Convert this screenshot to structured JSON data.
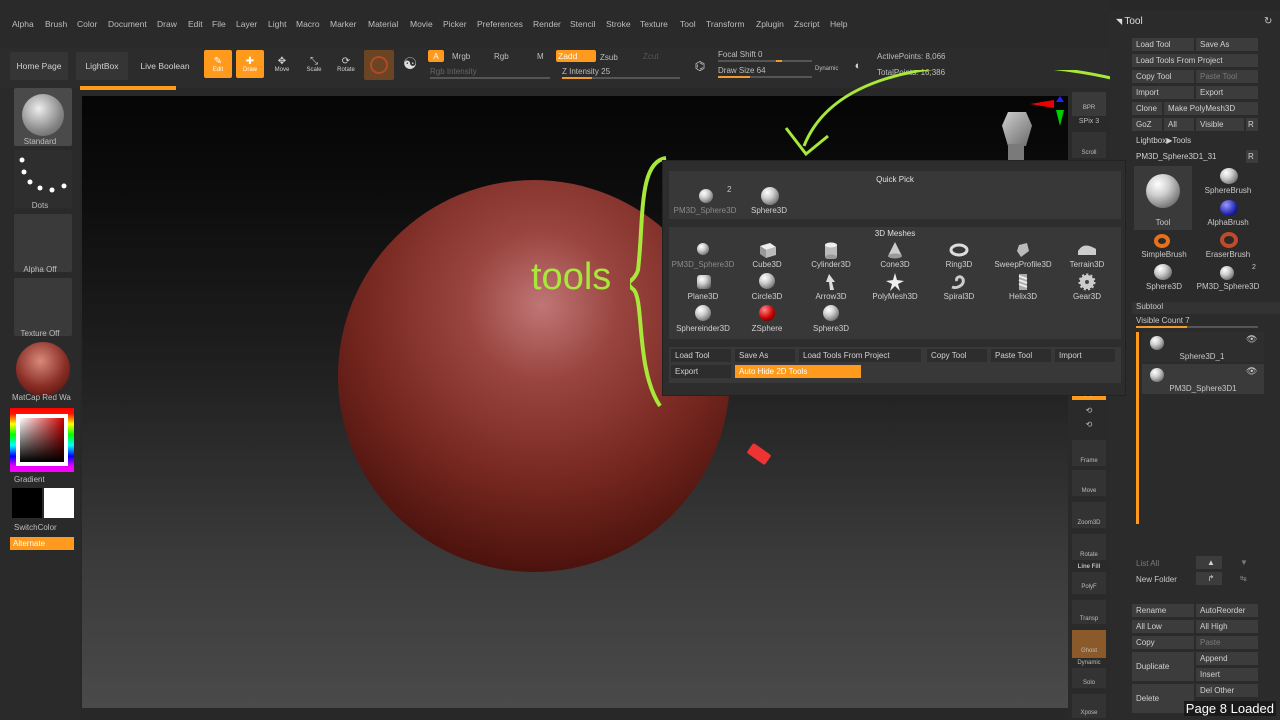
{
  "menu": [
    "Alpha",
    "Brush",
    "Color",
    "Document",
    "Draw",
    "Edit",
    "File",
    "Layer",
    "Light",
    "Macro",
    "Marker",
    "Material",
    "Movie",
    "Picker",
    "Preferences",
    "Render",
    "Stencil",
    "Stroke",
    "Texture",
    "Tool",
    "Transform",
    "Zplugin",
    "Zscript",
    "Help"
  ],
  "topbar": {
    "home": "Home Page",
    "lightbox": "LightBox",
    "liveboolean": "Live Boolean",
    "edit": "Edit",
    "draw": "Draw",
    "move": "Move",
    "scale": "Scale",
    "rotate": "Rotate",
    "a": "A",
    "mrgb": "Mrgb",
    "rgb": "Rgb",
    "m": "M",
    "zadd": "Zadd",
    "zsub": "Zsub",
    "zcut": "Zcut",
    "rgb_intensity": "Rgb Intensity",
    "z_intensity": "Z Intensity 25",
    "focal": "Focal Shift 0",
    "drawsize": "Draw Size 64",
    "dynamic": "Dynamic",
    "active": "ActivePoints: 8,066",
    "total": "TotalPoints: 16,386",
    "z_intensity_level": 0.25,
    "draw_size_level": 0.5
  },
  "left": {
    "standard": "Standard",
    "dots": "Dots",
    "alphaoff": "Alpha Off",
    "textureoff": "Texture Off",
    "matcap": "MatCap Red Wa",
    "gradient": "Gradient",
    "switchcolor": "SwitchColor",
    "alternate": "Alternate"
  },
  "annotation": "tools",
  "rightstrip": {
    "bpr": "BPR",
    "spix": "SPix 3",
    "scroll": "Scroll",
    "frame": "Frame",
    "move": "Move",
    "zoom3d": "Zoom3D",
    "rotate": "Rotate",
    "linefill": "Line Fill",
    "polyf": "PolyF",
    "transp": "Transp",
    "ghost": "Ghost",
    "dynamic": "Dynamic",
    "solo": "Solo",
    "xpose": "Xpose"
  },
  "tool": {
    "title": "Tool",
    "loadtool": "Load Tool",
    "saveas": "Save As",
    "loadfromproject": "Load Tools From Project",
    "copytool": "Copy Tool",
    "pastetool": "Paste Tool",
    "import": "Import",
    "export": "Export",
    "clone": "Clone",
    "makepolymesh": "Make PolyMesh3D",
    "goz": "GoZ",
    "all": "All",
    "visible": "Visible",
    "r": "R",
    "lightbox_tools": "Lightbox▶Tools",
    "current": "PM3D_Sphere3D1_31",
    "r2": "R",
    "tool_label": "Tool",
    "spherebrush": "SphereBrush",
    "alphabrush": "AlphaBrush",
    "simplebrush": "SimpleBrush",
    "eraserbrush": "EraserBrush",
    "sphere3d": "Sphere3D",
    "pm3d": "PM3D_Sphere3D",
    "two": "2",
    "subtool": "Subtool",
    "visiblecount": "Visible Count 7",
    "sub1": "Sphere3D_1",
    "sub2": "PM3D_Sphere3D1",
    "listall": "List All",
    "newfolder": "New Folder",
    "rename": "Rename",
    "autoreorder": "AutoReorder",
    "alllow": "All Low",
    "allhigh": "All High",
    "copy": "Copy",
    "paste": "Paste",
    "duplicate": "Duplicate",
    "append": "Append",
    "insert": "Insert",
    "delete": "Delete",
    "delother": "Del Other"
  },
  "popup": {
    "quickpick": "Quick Pick",
    "quick": [
      {
        "label": "PM3D_Sphere3D",
        "badge": "2"
      },
      {
        "label": "Sphere3D",
        "badge": ""
      }
    ],
    "meshes_title": "3D Meshes",
    "meshes": [
      "PM3D_Sphere3D",
      "Cube3D",
      "Cylinder3D",
      "Cone3D",
      "Ring3D",
      "SweepProfile3D",
      "Terrain3D",
      "Plane3D",
      "Circle3D",
      "Arrow3D",
      "PolyMesh3D",
      "Spiral3D",
      "Helix3D",
      "Gear3D",
      "Sphereinder3D",
      "ZSphere",
      "Sphere3D"
    ],
    "buttons": {
      "loadtool": "Load Tool",
      "saveas": "Save As",
      "loadfromproject": "Load Tools From Project",
      "copytool": "Copy Tool",
      "pastetool": "Paste Tool",
      "import": "Import",
      "export": "Export",
      "autohide": "Auto Hide 2D Tools"
    }
  },
  "status": "Page 8 Loaded",
  "colors": {
    "accent": "#ff9a1c",
    "annotation": "#a7e83a",
    "material": "#8a2e26"
  }
}
